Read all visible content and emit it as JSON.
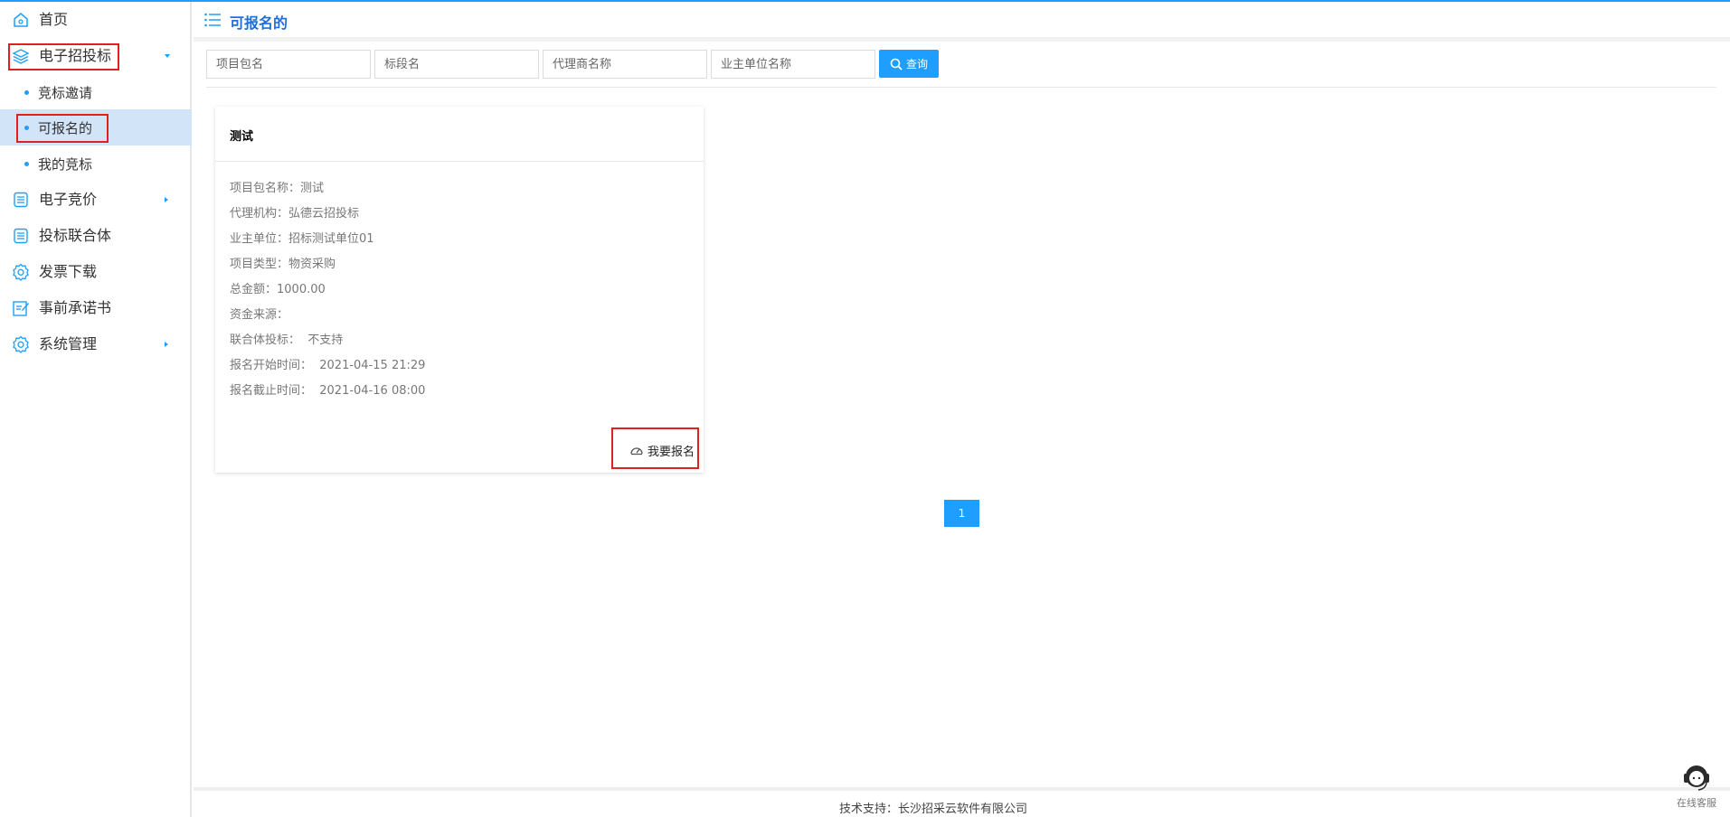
{
  "sidebar": {
    "items": [
      {
        "label": "首页",
        "icon": "home-icon"
      },
      {
        "label": "电子招投标",
        "icon": "layers-icon"
      },
      {
        "label": "电子竞价",
        "icon": "list-icon"
      },
      {
        "label": "投标联合体",
        "icon": "list-icon"
      },
      {
        "label": "发票下载",
        "icon": "gear-icon"
      },
      {
        "label": "事前承诺书",
        "icon": "edit-doc-icon"
      },
      {
        "label": "系统管理",
        "icon": "gear-icon"
      }
    ],
    "sub_items": [
      {
        "label": "竞标邀请"
      },
      {
        "label": "可报名的"
      },
      {
        "label": "我的竞标"
      }
    ]
  },
  "header": {
    "title": "可报名的"
  },
  "search": {
    "package_placeholder": "项目包名",
    "section_placeholder": "标段名",
    "agent_placeholder": "代理商名称",
    "owner_placeholder": "业主单位名称",
    "button_label": "查询"
  },
  "card": {
    "title": "测试",
    "rows": [
      "项目包名称：测试",
      "代理机构：弘德云招投标",
      "业主单位：招标测试单位01",
      "项目类型：物资采购",
      "总金额：1000.00",
      "资金来源：",
      "联合体投标：  不支持",
      "报名开始时间：  2021-04-15 21:29",
      "报名截止时间：  2021-04-16 08:00"
    ],
    "signup_label": "我要报名"
  },
  "pagination": {
    "current": "1"
  },
  "footer": {
    "text": "技术支持：长沙招采云软件有限公司"
  },
  "online_service": {
    "label": "在线客服"
  },
  "colors": {
    "accent": "#1e9fff",
    "title_blue": "#1e6fd9",
    "highlight": "#e02020",
    "active_bg": "#d2e4f7"
  }
}
